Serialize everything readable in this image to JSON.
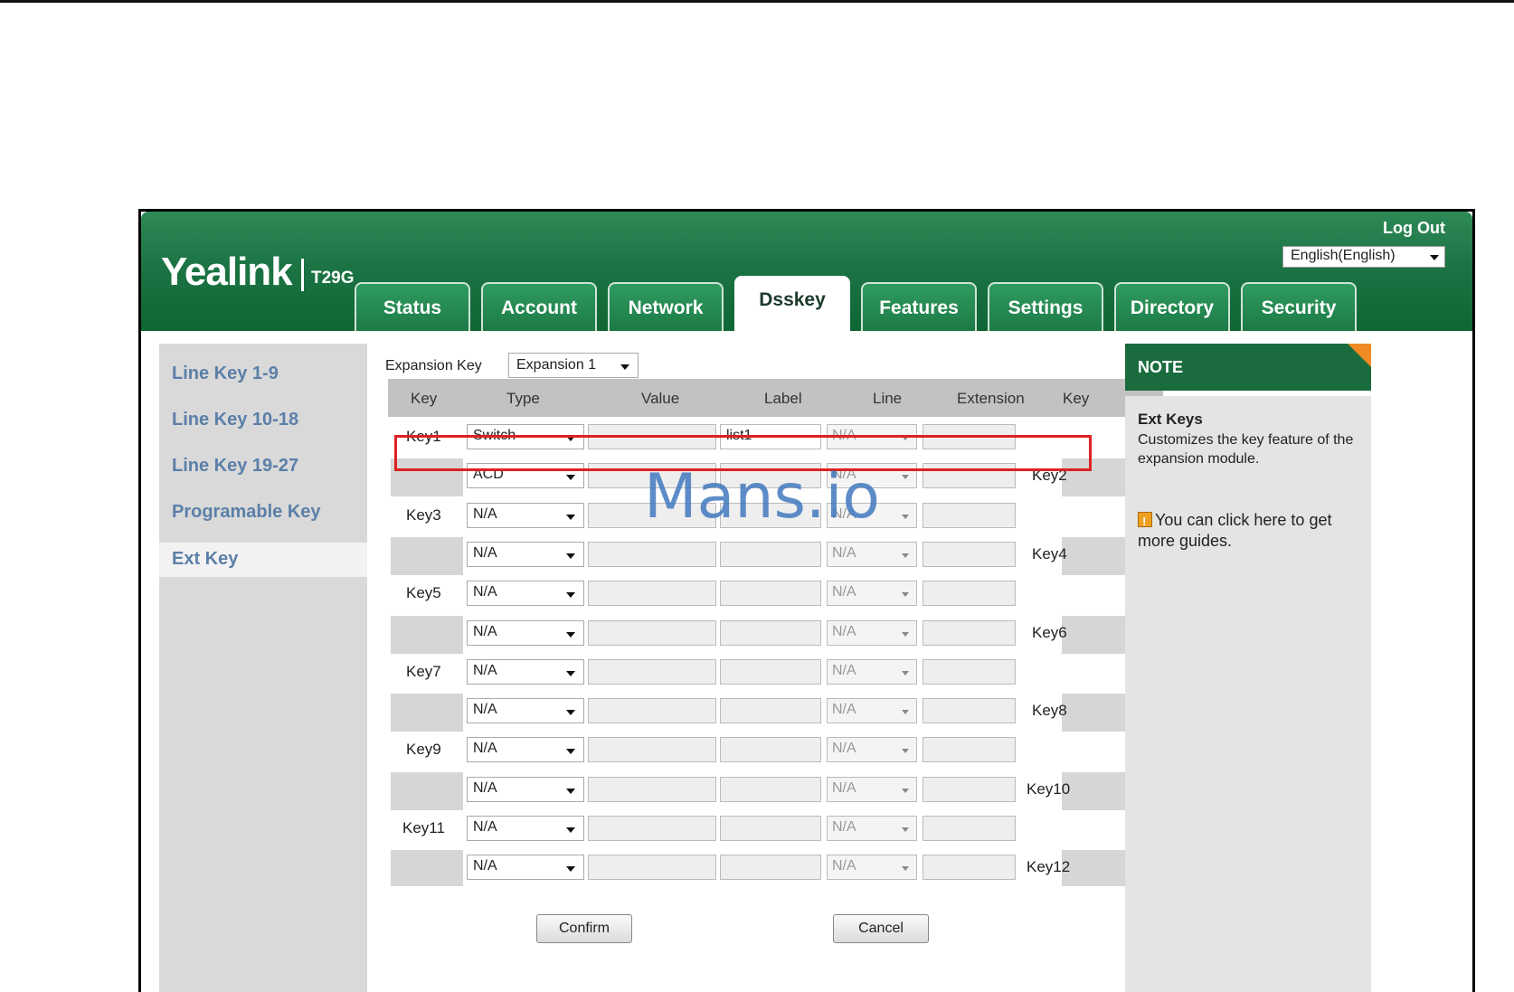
{
  "header": {
    "logo_text": "Yealink",
    "model": "T29G",
    "logout_label": "Log Out",
    "language": "English(English)"
  },
  "tabs": [
    "Status",
    "Account",
    "Network",
    "Dsskey",
    "Features",
    "Settings",
    "Directory",
    "Security"
  ],
  "active_tab": "Dsskey",
  "sidebar": {
    "items": [
      "Line Key 1-9",
      "Line Key 10-18",
      "Line Key 19-27",
      "Programable Key",
      "Ext Key"
    ],
    "active": "Ext Key"
  },
  "expansion": {
    "label": "Expansion Key",
    "value": "Expansion 1"
  },
  "table": {
    "headers": [
      "Key",
      "Type",
      "Value",
      "Label",
      "Line",
      "Extension",
      "Key"
    ],
    "rows": [
      {
        "key_left": "Key1",
        "type": "Switch",
        "value": "",
        "label": "list1",
        "line": "N/A",
        "extension": "",
        "key_right": ""
      },
      {
        "key_left": "",
        "type": "ACD",
        "value": "",
        "label": "",
        "line": "N/A",
        "extension": "",
        "key_right": "Key2"
      },
      {
        "key_left": "Key3",
        "type": "N/A",
        "value": "",
        "label": "",
        "line": "N/A",
        "extension": "",
        "key_right": ""
      },
      {
        "key_left": "",
        "type": "N/A",
        "value": "",
        "label": "",
        "line": "N/A",
        "extension": "",
        "key_right": "Key4"
      },
      {
        "key_left": "Key5",
        "type": "N/A",
        "value": "",
        "label": "",
        "line": "N/A",
        "extension": "",
        "key_right": ""
      },
      {
        "key_left": "",
        "type": "N/A",
        "value": "",
        "label": "",
        "line": "N/A",
        "extension": "",
        "key_right": "Key6"
      },
      {
        "key_left": "Key7",
        "type": "N/A",
        "value": "",
        "label": "",
        "line": "N/A",
        "extension": "",
        "key_right": ""
      },
      {
        "key_left": "",
        "type": "N/A",
        "value": "",
        "label": "",
        "line": "N/A",
        "extension": "",
        "key_right": "Key8"
      },
      {
        "key_left": "Key9",
        "type": "N/A",
        "value": "",
        "label": "",
        "line": "N/A",
        "extension": "",
        "key_right": ""
      },
      {
        "key_left": "",
        "type": "N/A",
        "value": "",
        "label": "",
        "line": "N/A",
        "extension": "",
        "key_right": "Key10"
      },
      {
        "key_left": "Key11",
        "type": "N/A",
        "value": "",
        "label": "",
        "line": "N/A",
        "extension": "",
        "key_right": ""
      },
      {
        "key_left": "",
        "type": "N/A",
        "value": "",
        "label": "",
        "line": "N/A",
        "extension": "",
        "key_right": "Key12"
      }
    ]
  },
  "buttons": {
    "confirm": "Confirm",
    "cancel": "Cancel"
  },
  "note": {
    "heading": "NOTE",
    "title": "Ext Keys",
    "description": "Customizes the key feature of the expansion module.",
    "guide": "You can click here to get more guides."
  },
  "watermark": "Mans.io",
  "colors": {
    "header_green": "#1c7444",
    "sidebar_link": "#5b7fa8",
    "highlight_red": "#e02020",
    "note_corner": "#f08a24"
  }
}
